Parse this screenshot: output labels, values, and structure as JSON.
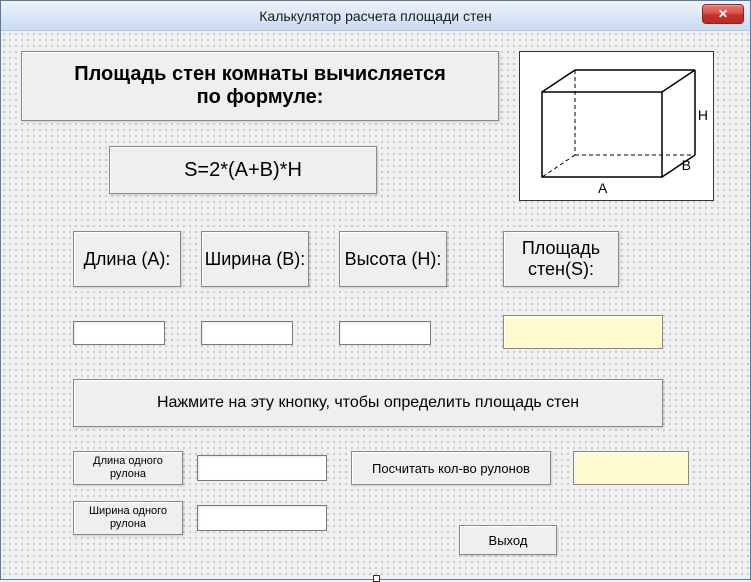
{
  "window": {
    "title": "Калькулятор расчета  площади стен"
  },
  "header": {
    "line1": "Площадь стен комнаты вычисляется",
    "line2": "по формуле:"
  },
  "formula": "S=2*(A+B)*H",
  "diagram": {
    "labelA": "A",
    "labelB": "B",
    "labelH": "H"
  },
  "fields": {
    "lengthLabel": "Длина (A):",
    "widthLabel": "Ширина (B):",
    "heightLabel": "Высота (H):",
    "areaLabel": "Площадь стен(S):",
    "lengthValue": "",
    "widthValue": "",
    "heightValue": "",
    "areaValue": ""
  },
  "buttons": {
    "calcArea": "Нажмите на эту кнопку, чтобы определить площадь стен",
    "calcRolls": "Посчитать кол-во рулонов",
    "exit": "Выход"
  },
  "roll": {
    "lengthLabel": "Длина одного рулона",
    "widthLabel": "Ширина одного рулона",
    "lengthValue": "",
    "widthValue": "",
    "countValue": ""
  }
}
